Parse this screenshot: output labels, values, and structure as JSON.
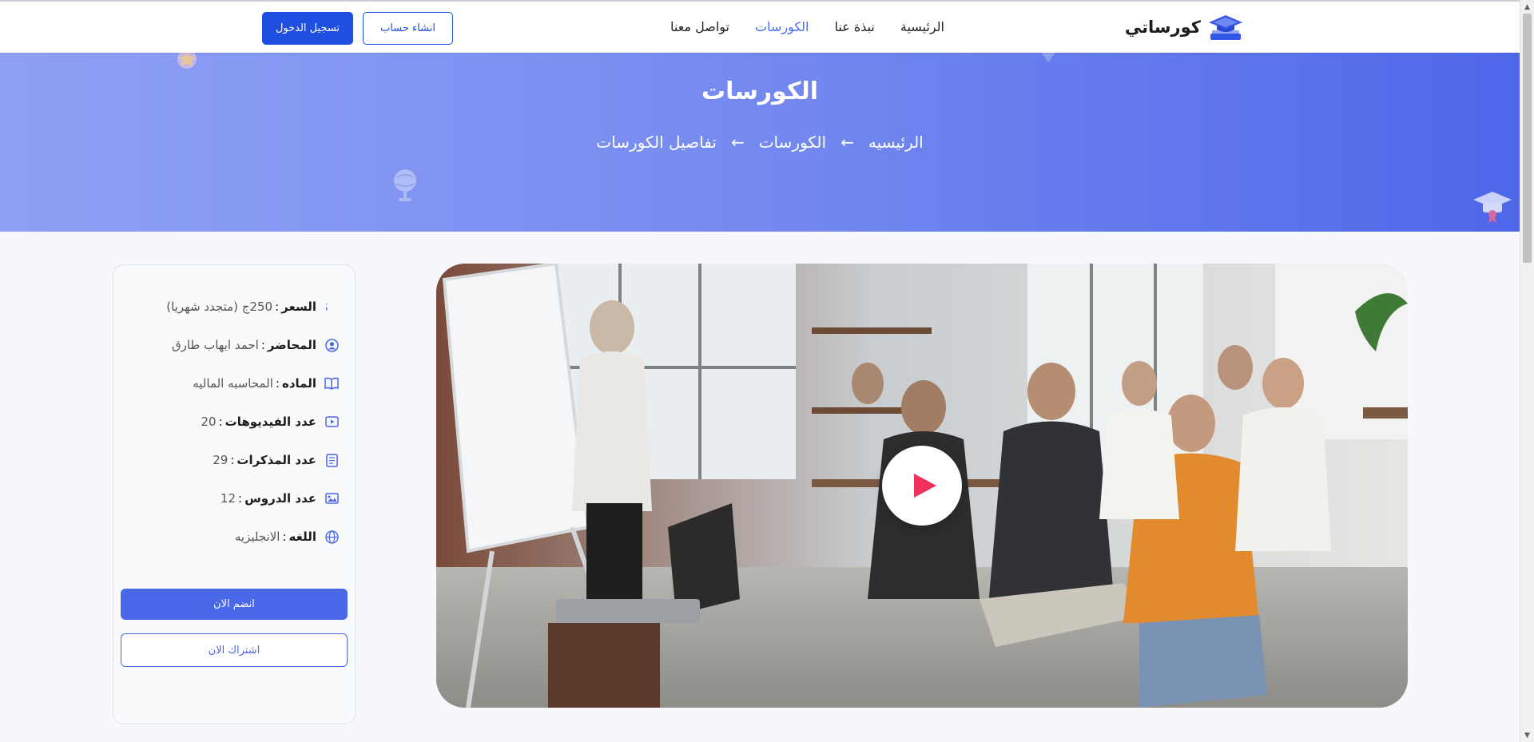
{
  "brand": {
    "name": "كورساتي",
    "logo_icon": "graduation-cap-icon"
  },
  "nav": {
    "links": [
      {
        "label": "الرئيسية",
        "active": false
      },
      {
        "label": "نبذة عنا",
        "active": false
      },
      {
        "label": "الكورسات",
        "active": true
      },
      {
        "label": "تواصل معنا",
        "active": false
      }
    ],
    "register_label": "انشاء حساب",
    "login_label": "تسجيل الدخول"
  },
  "hero": {
    "title": "الكورسات",
    "breadcrumb": [
      "الرئيسيه",
      "الكورسات",
      "تفاصيل الكورسات"
    ],
    "arrow": "←"
  },
  "course": {
    "video": {
      "play_icon": "play-icon",
      "description": "classroom presentation"
    },
    "info": [
      {
        "icon": "dollar-icon",
        "label": "السعر",
        "sep": ":",
        "value": "250ج (متجدد شهريا)"
      },
      {
        "icon": "user-circle-icon",
        "label": "المحاضر",
        "sep": ":",
        "value": "احمد ايهاب طارق"
      },
      {
        "icon": "book-icon",
        "label": "الماده",
        "sep": ":",
        "value": "المحاسبه الماليه"
      },
      {
        "icon": "video-icon",
        "label": "عدد الفيديوهات",
        "sep": ":",
        "value": "20"
      },
      {
        "icon": "notes-icon",
        "label": "عدد المذكرات",
        "sep": ":",
        "value": "29"
      },
      {
        "icon": "image-icon",
        "label": "عدد الدروس",
        "sep": ":",
        "value": "12"
      },
      {
        "icon": "globe-icon",
        "label": "اللغه",
        "sep": ":",
        "value": "الانجليزيه"
      }
    ],
    "join_label": "انضم الان",
    "subscribe_label": "اشتراك الان"
  },
  "colors": {
    "primary": "#1f4fe0",
    "accent": "#4a67e8",
    "play": "#f0325a"
  }
}
